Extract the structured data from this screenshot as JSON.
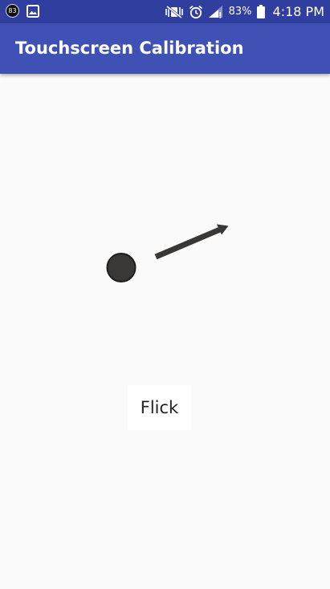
{
  "status_bar": {
    "notification_count": "83",
    "battery_percent": "83%",
    "time": "4:18 PM",
    "icons": [
      "notification-count-icon",
      "image-icon",
      "vibrate-mute-icon",
      "alarm-icon",
      "signal-icon",
      "battery-icon"
    ]
  },
  "app_bar": {
    "title": "Touchscreen Calibration"
  },
  "calibration": {
    "gesture_label": "Flick",
    "target_icon": "touch-target-dot",
    "direction_icon": "flick-arrow"
  },
  "colors": {
    "status_bar": "#303f9f",
    "app_bar": "#3f51b5",
    "background": "#fafafa",
    "target_fill": "#3a3836",
    "arrow": "#3a3836"
  }
}
